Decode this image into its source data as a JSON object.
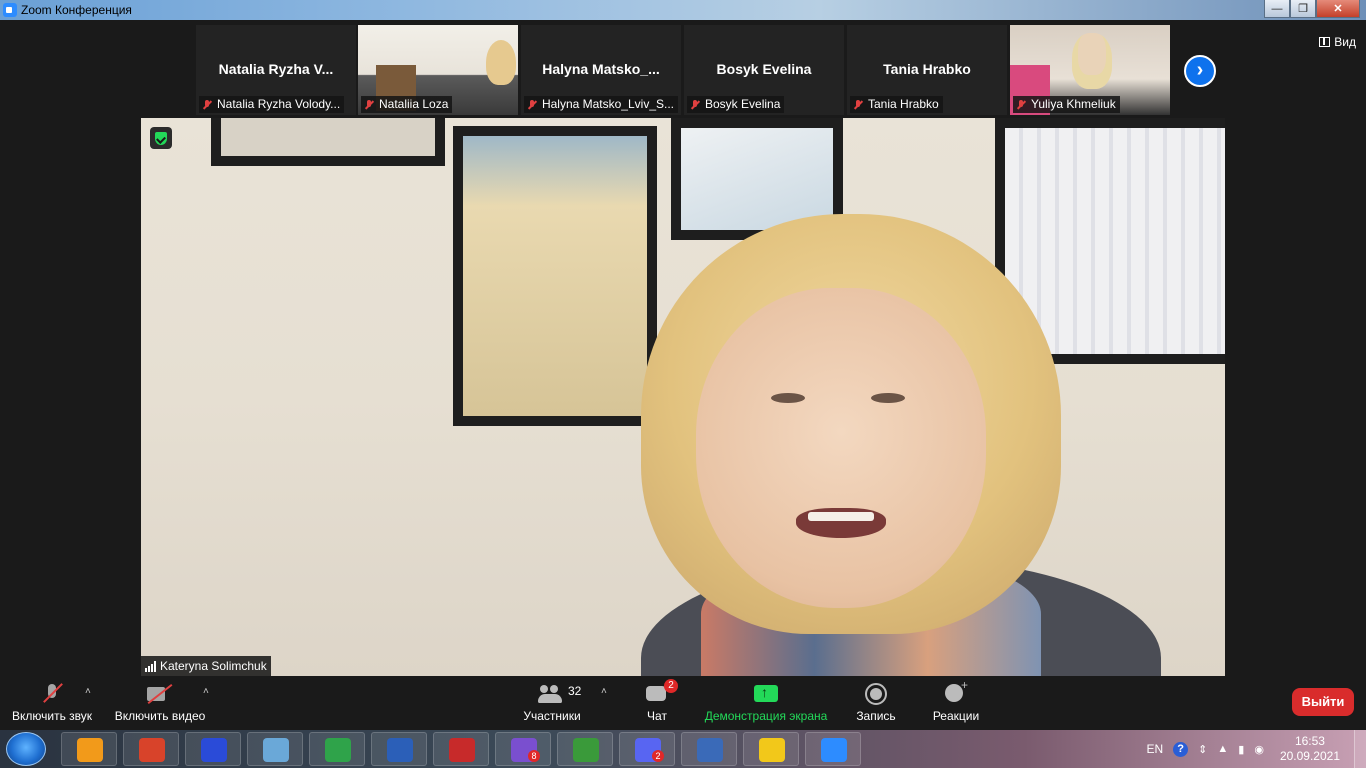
{
  "window": {
    "title": "Zoom Конференция",
    "controls": [
      "minimize",
      "restore",
      "close"
    ]
  },
  "gallery": {
    "tiles": [
      {
        "big_name": "Natalia  Ryzha  V...",
        "caption": "Natalia Ryzha Volody...",
        "muted": true,
        "video": false
      },
      {
        "big_name": "",
        "caption": "Nataliia Loza",
        "muted": true,
        "video": true
      },
      {
        "big_name": "Halyna  Matsko_...",
        "caption": "Halyna Matsko_Lviv_S...",
        "muted": true,
        "video": false
      },
      {
        "big_name": "Bosyk Evelina",
        "caption": "Bosyk Evelina",
        "muted": true,
        "video": false
      },
      {
        "big_name": "Tania Hrabko",
        "caption": "Tania Hrabko",
        "muted": true,
        "video": false
      },
      {
        "big_name": "",
        "caption": "Yuliya Khmeliuk",
        "muted": true,
        "video": true
      }
    ],
    "view_label": "Вид"
  },
  "main_video": {
    "speaker_name": "Kateryna Solimchuk",
    "encryption": "shield-check-icon"
  },
  "toolbar": {
    "unmute_label": "Включить звук",
    "start_video_label": "Включить видео",
    "participants_label": "Участники",
    "participants_count": "32",
    "chat_label": "Чат",
    "chat_badge": "2",
    "share_label": "Демонстрация экрана",
    "record_label": "Запись",
    "reactions_label": "Реакции",
    "leave_label": "Выйти"
  },
  "taskbar": {
    "apps": [
      {
        "name": "avast-icon",
        "color": "#f29a1a",
        "badge": ""
      },
      {
        "name": "presentation-icon",
        "color": "#d8432a",
        "badge": ""
      },
      {
        "name": "ldoce-dictionary-icon",
        "color": "#2a4bd8",
        "badge": ""
      },
      {
        "name": "audio-icon",
        "color": "#6aa8d8",
        "badge": ""
      },
      {
        "name": "k-app-icon",
        "color": "#2fa34a",
        "badge": ""
      },
      {
        "name": "word-icon",
        "color": "#2b5fb8",
        "badge": ""
      },
      {
        "name": "red-book-icon",
        "color": "#c72a2a",
        "badge": ""
      },
      {
        "name": "viber-icon",
        "color": "#7a4fcf",
        "badge": "8"
      },
      {
        "name": "chrome-icon",
        "color": "#3a9a3a",
        "badge": ""
      },
      {
        "name": "discord-icon",
        "color": "#5865f2",
        "badge": "2"
      },
      {
        "name": "board-app-icon",
        "color": "#3a6ab8",
        "badge": ""
      },
      {
        "name": "player-icon",
        "color": "#f2c81a",
        "badge": ""
      },
      {
        "name": "zoom-icon",
        "color": "#2d8cff",
        "badge": ""
      }
    ],
    "language": "EN",
    "time": "16:53",
    "date": "20.09.2021"
  },
  "colors": {
    "accent_blue": "#0e72ed",
    "share_green": "#23d959",
    "leave_red": "#d92c2c",
    "mute_red": "#e04040"
  }
}
